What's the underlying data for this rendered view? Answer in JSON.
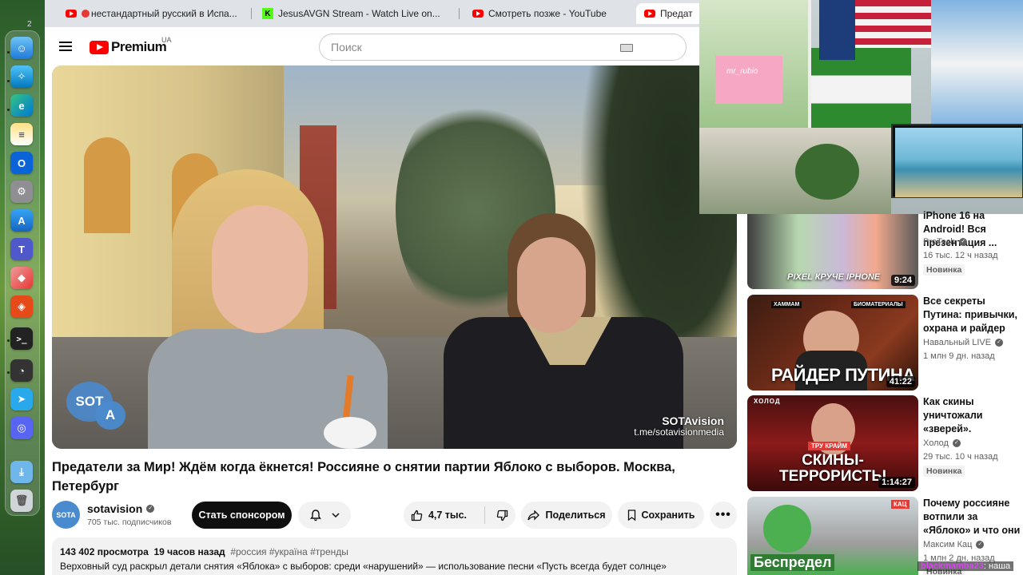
{
  "browser": {
    "tabs": [
      {
        "title": "нестандартный русский в Испа..."
      },
      {
        "title": "JesusAVGN Stream - Watch Live on..."
      },
      {
        "title": "Смотреть позже - YouTube"
      },
      {
        "title": "Предат"
      }
    ]
  },
  "dock": {
    "badge": "2"
  },
  "youtube": {
    "logo_text": "Premium",
    "region": "UA",
    "search_placeholder": "Поиск"
  },
  "video": {
    "watermark_name": "SOTAvision",
    "watermark_link": "t.me/sotavisionmedia",
    "logo_top": "SOT",
    "logo_bottom": "A"
  },
  "watch": {
    "title": "Предатели за Мир! Ждём когда ёкнется! Россияне о снятии партии Яблоко с выборов. Москва, Петербург",
    "channel": {
      "name": "sotavision",
      "subscribers": "705 тыс. подписчиков",
      "avatar_text": "SOTA"
    },
    "buttons": {
      "sponsor": "Стать спонсором",
      "likes": "4,7 тыс.",
      "share": "Поделиться",
      "save": "Сохранить"
    },
    "description": {
      "views": "143 402 просмотра",
      "age": "19 часов назад",
      "tags": "#россия #україна #тренды",
      "text": "Верховный суд раскрыл детали снятия «Яблока» с выборов: среди «нарушений» — использование песни «Пусть всегда будет солнце»"
    }
  },
  "stream_overlay": {
    "neon_sign": "mr_rubio"
  },
  "recommendations": [
    {
      "title": "iPhone 16 на Android! Вся презентация ...",
      "channel": "ProTech",
      "meta": "16 тыс.  12 ч назад",
      "badge": "Новинка",
      "duration": "9:24",
      "thumb_text": "PIXEL КРУЧЕ IPHONE"
    },
    {
      "title": "Все секреты Путина: привычки, охрана и райдер",
      "channel": "Навальный LIVE",
      "meta": "1 млн  9 дн. назад",
      "badge": "",
      "duration": "41:22",
      "thumb_text": "РАЙДЕР ПУТИНА",
      "thumb_tag1": "ХАММАМ",
      "thumb_tag2": "БИОМАТЕРИАЛЫ"
    },
    {
      "title": "Как скины уничтожали «зверей». Черкизон...",
      "channel": "Холод",
      "meta": "29 тыс.  10 ч назад",
      "badge": "Новинка",
      "duration": "1:14:27",
      "thumb_text": "СКИНЫ- ТЕРРОРИСТЫ",
      "thumb_tag1": "ХОЛОД",
      "thumb_tag2": "ТРУ КРАЙМ"
    },
    {
      "title": "Почему россияне вотпили за «Яблоко» и что они будут ...",
      "channel": "Максим Кац",
      "meta": "1 млн  2 дн. назад",
      "badge": "Новинка",
      "duration": "",
      "thumb_text": "Беспредел",
      "thumb_tag1": "КАЦ"
    }
  ],
  "chat": {
    "user": "blackmamba23",
    "message": ": наша"
  }
}
